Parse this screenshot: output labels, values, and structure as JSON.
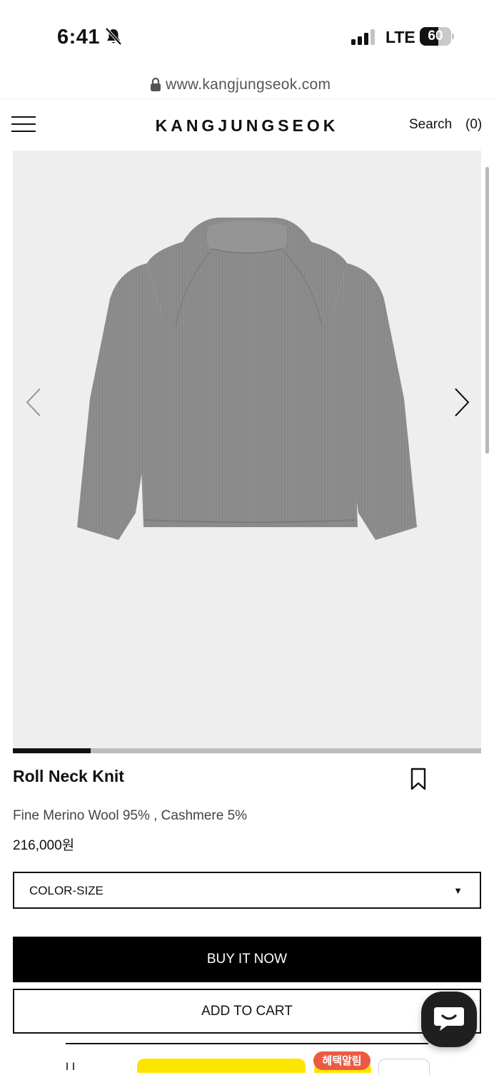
{
  "status_bar": {
    "time": "6:41",
    "network": "LTE",
    "battery_level": "60",
    "battery_fraction": 0.6
  },
  "browser": {
    "url": "www.kangjungseok.com"
  },
  "header": {
    "logo": "KANGJUNGSEOK",
    "search_label": "Search",
    "cart_count": "(0)"
  },
  "gallery": {
    "image_subject": "grey-roll-neck-sweater",
    "current_slide_fraction": 0.166,
    "sweater_color": "#8d8d8d",
    "background_color": "#eeeeee"
  },
  "product": {
    "name": "Roll Neck Knit",
    "material": "Fine Merino Wool 95% , Cashmere 5%",
    "price": "216,000원"
  },
  "options": {
    "selected": "COLOR-SIZE"
  },
  "actions": {
    "buy_now": "BUY IT NOW",
    "add_to_cart": "ADD TO CART"
  },
  "bottom_bar": {
    "benefit_badge": "혜택알림",
    "partial_text": "l l"
  },
  "icons": [
    "bell-slash-icon",
    "signal-icon",
    "battery-icon",
    "lock-icon",
    "hamburger-menu-icon",
    "chevron-left-icon",
    "chevron-right-icon",
    "bookmark-icon",
    "chat-icon"
  ],
  "colors": {
    "accent_dark": "#000000",
    "badge_red": "#ec5a42",
    "kakao_yellow": "#fde500"
  }
}
